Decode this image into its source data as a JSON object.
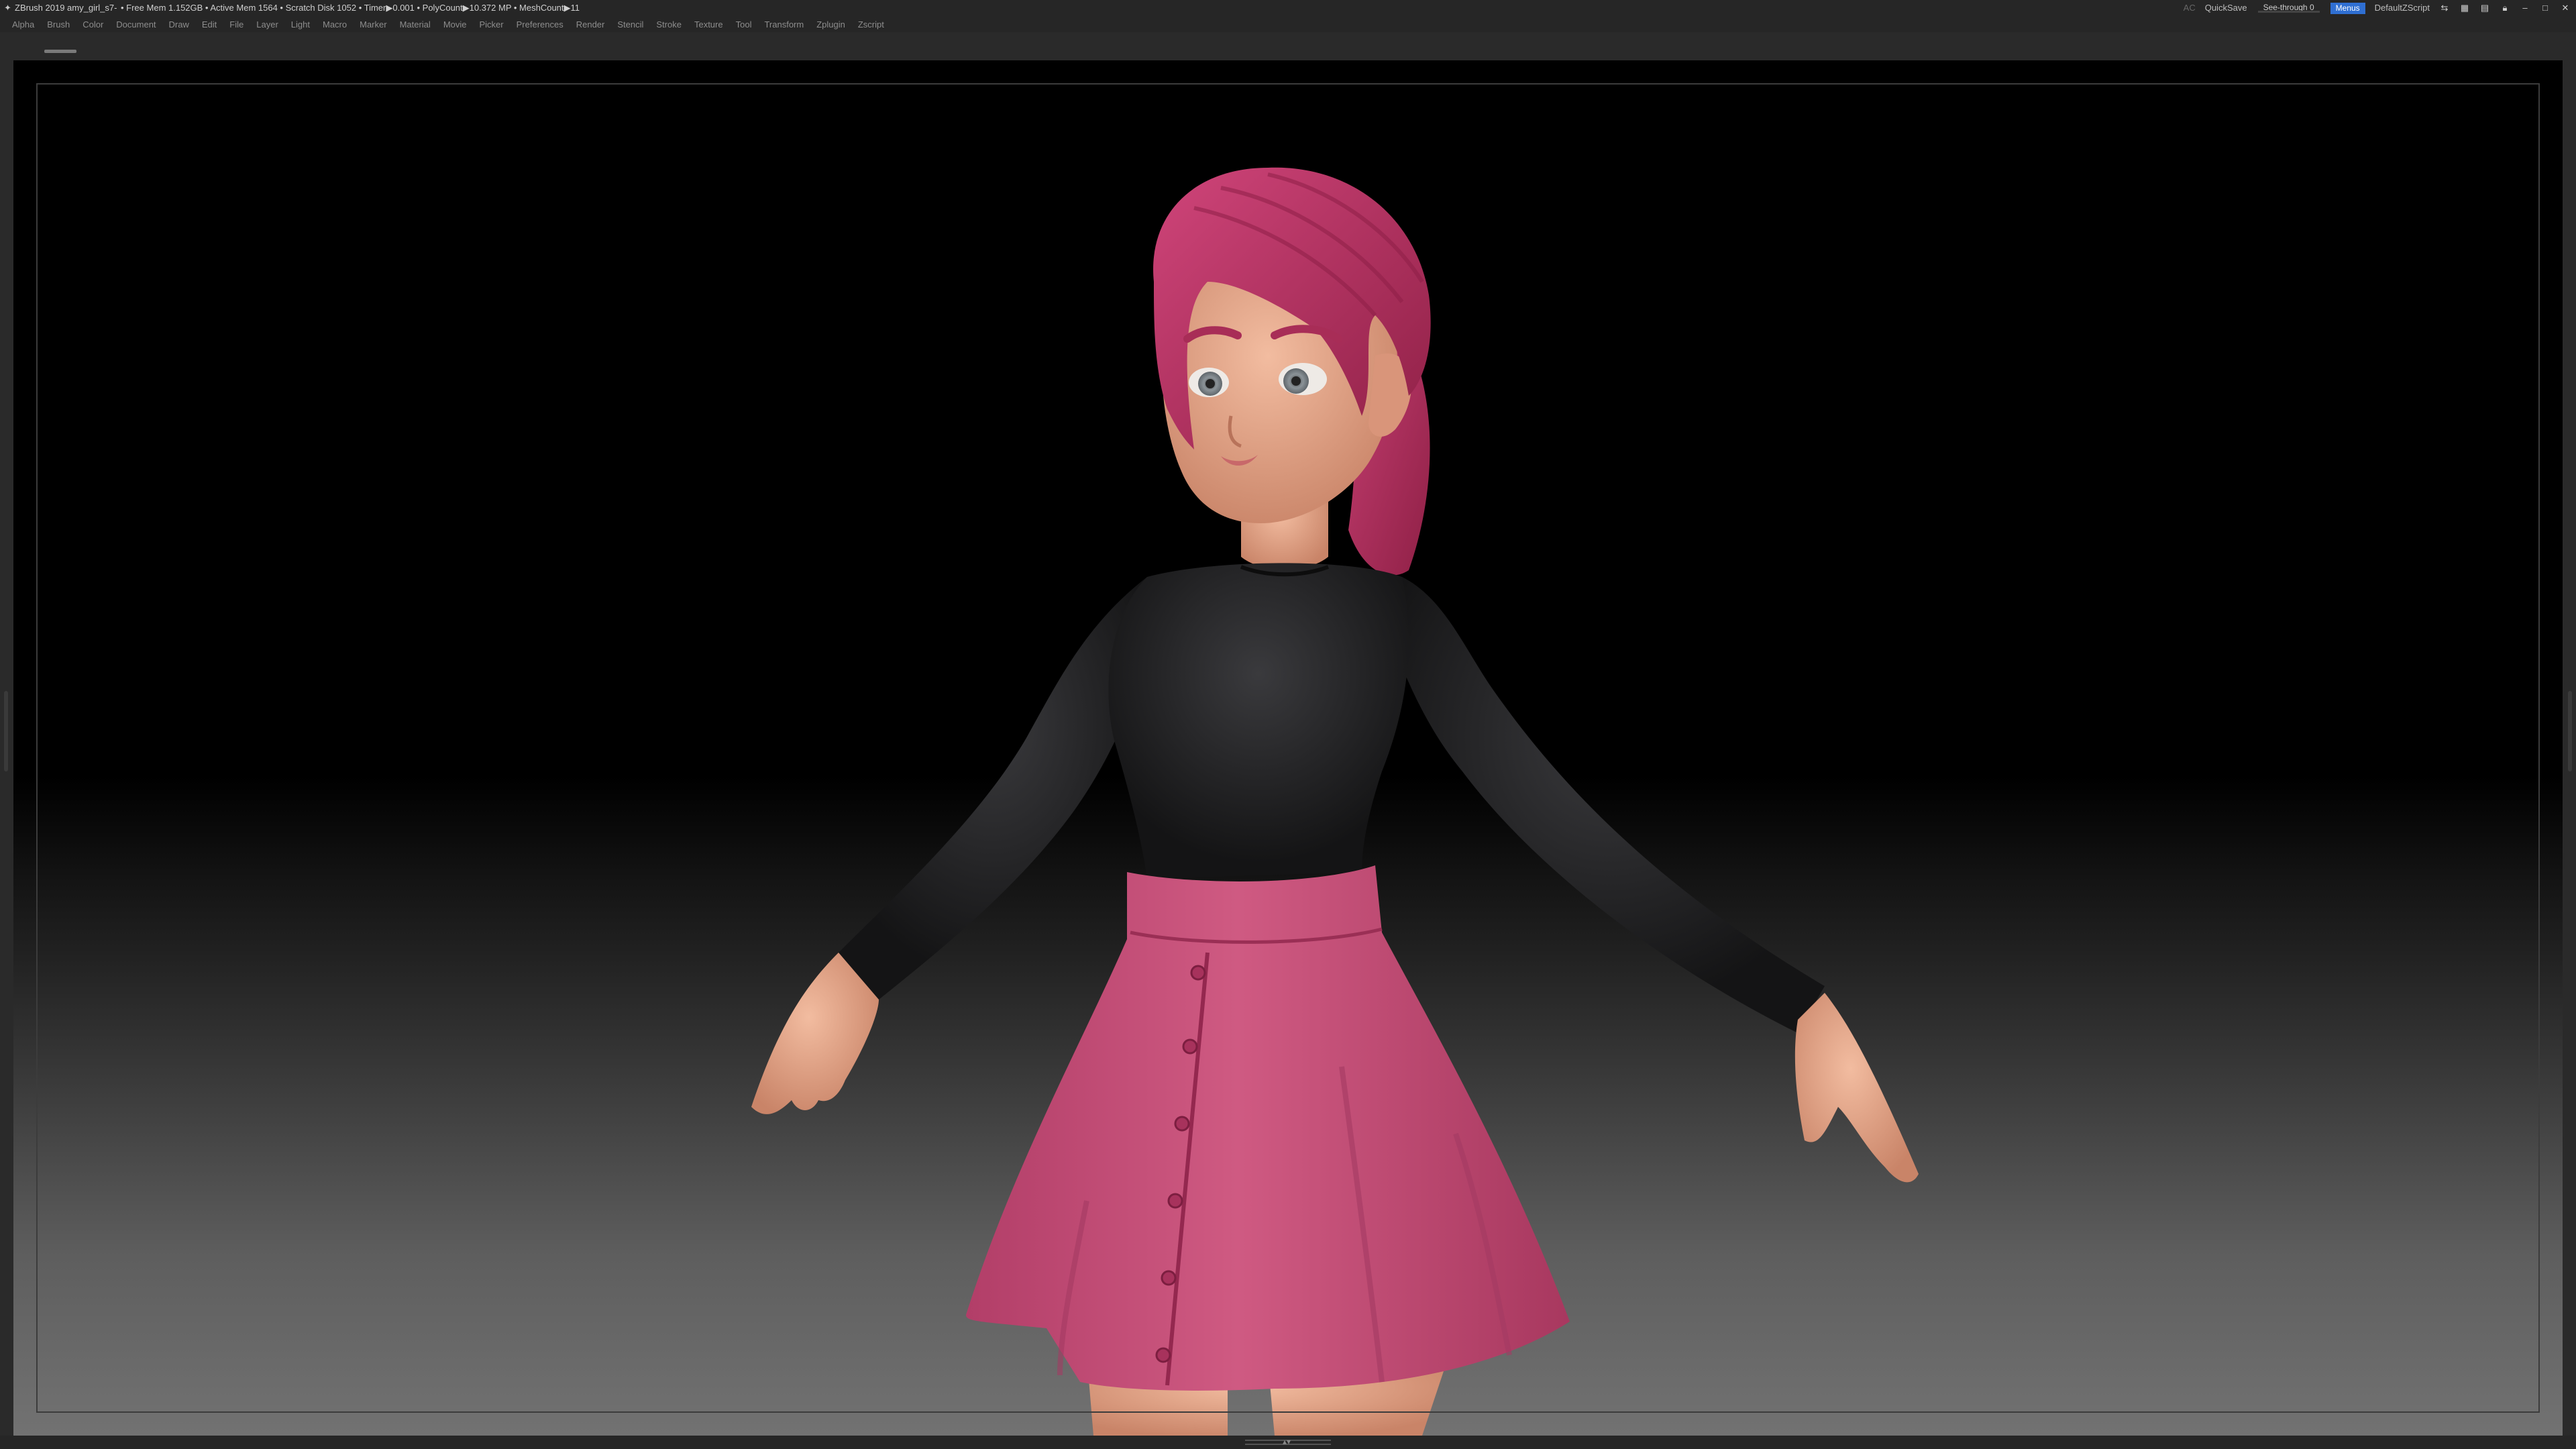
{
  "titlebar": {
    "app_title": "ZBrush 2019   amy_girl_s7-",
    "stats": "• Free Mem 1.152GB • Active Mem 1564 • Scratch Disk 1052 • Timer▶0.001 • PolyCount▶10.372 MP  • MeshCount▶11",
    "ac_label": "AC",
    "quicksave_label": "QuickSave",
    "seethrough_label": "See-through   0",
    "seethrough_value": 0,
    "menus_label": "Menus",
    "script_label": "DefaultZScript"
  },
  "menubar": {
    "items": [
      "Alpha",
      "Brush",
      "Color",
      "Document",
      "Draw",
      "Edit",
      "File",
      "Layer",
      "Light",
      "Macro",
      "Marker",
      "Material",
      "Movie",
      "Picker",
      "Preferences",
      "Render",
      "Stencil",
      "Stroke",
      "Texture",
      "Tool",
      "Transform",
      "Zplugin",
      "Zscript"
    ]
  },
  "colors": {
    "hair": "#b8325e",
    "skin": "#e7a78a",
    "shirt": "#1c1c1e",
    "skirt": "#c24a74",
    "ui_accent": "#2f6fd2"
  }
}
